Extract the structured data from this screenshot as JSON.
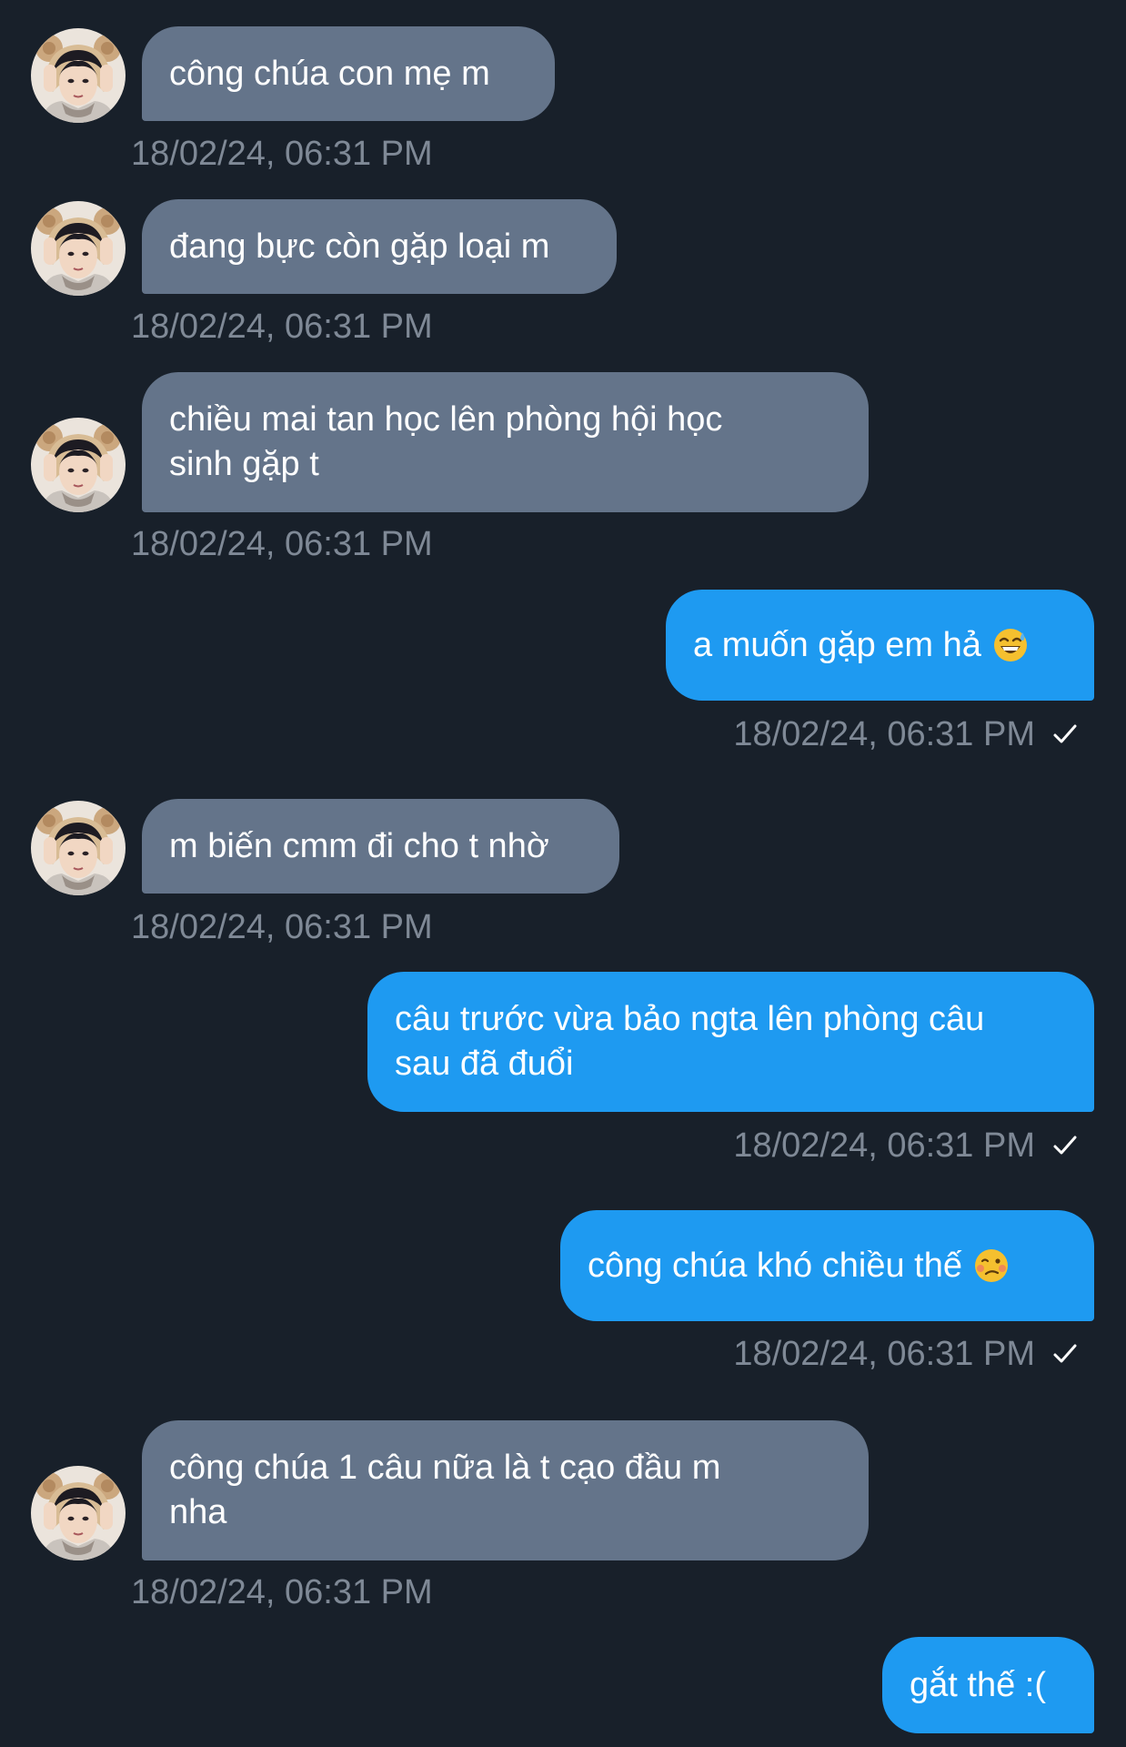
{
  "colors": {
    "background": "#18202a",
    "incoming_bubble": "#64748a",
    "outgoing_bubble": "#1e9af1",
    "timestamp": "#7f8996"
  },
  "messages": [
    {
      "direction": "incoming",
      "text": "công chúa con mẹ m",
      "time": "18/02/24, 06:31 PM"
    },
    {
      "direction": "incoming",
      "text": "đang bực còn gặp loại m",
      "time": "18/02/24, 06:31 PM"
    },
    {
      "direction": "incoming",
      "text": "chiều mai tan học lên phòng hội học\nsinh gặp t",
      "time": "18/02/24, 06:31 PM"
    },
    {
      "direction": "outgoing",
      "text": "a muốn gặp em hả",
      "emoji": "grinning-sweat-emoji",
      "time": "18/02/24, 06:31 PM",
      "status_icon": "read-check-icon"
    },
    {
      "direction": "incoming",
      "text": "m biến cmm đi cho t nhờ",
      "time": "18/02/24, 06:31 PM"
    },
    {
      "direction": "outgoing",
      "text": "câu trước vừa bảo ngta lên phòng câu\nsau đã đuổi",
      "time": "18/02/24, 06:31 PM",
      "status_icon": "read-check-icon"
    },
    {
      "direction": "outgoing",
      "text": "công chúa khó chiều thế",
      "emoji": "woozy-face-emoji",
      "time": "18/02/24, 06:31 PM",
      "status_icon": "read-check-icon"
    },
    {
      "direction": "incoming",
      "text": "công chúa 1 câu nữa là t cạo đầu m\nnha",
      "time": "18/02/24, 06:31 PM"
    },
    {
      "direction": "outgoing",
      "text": "gắt thế :(",
      "time": ""
    }
  ]
}
